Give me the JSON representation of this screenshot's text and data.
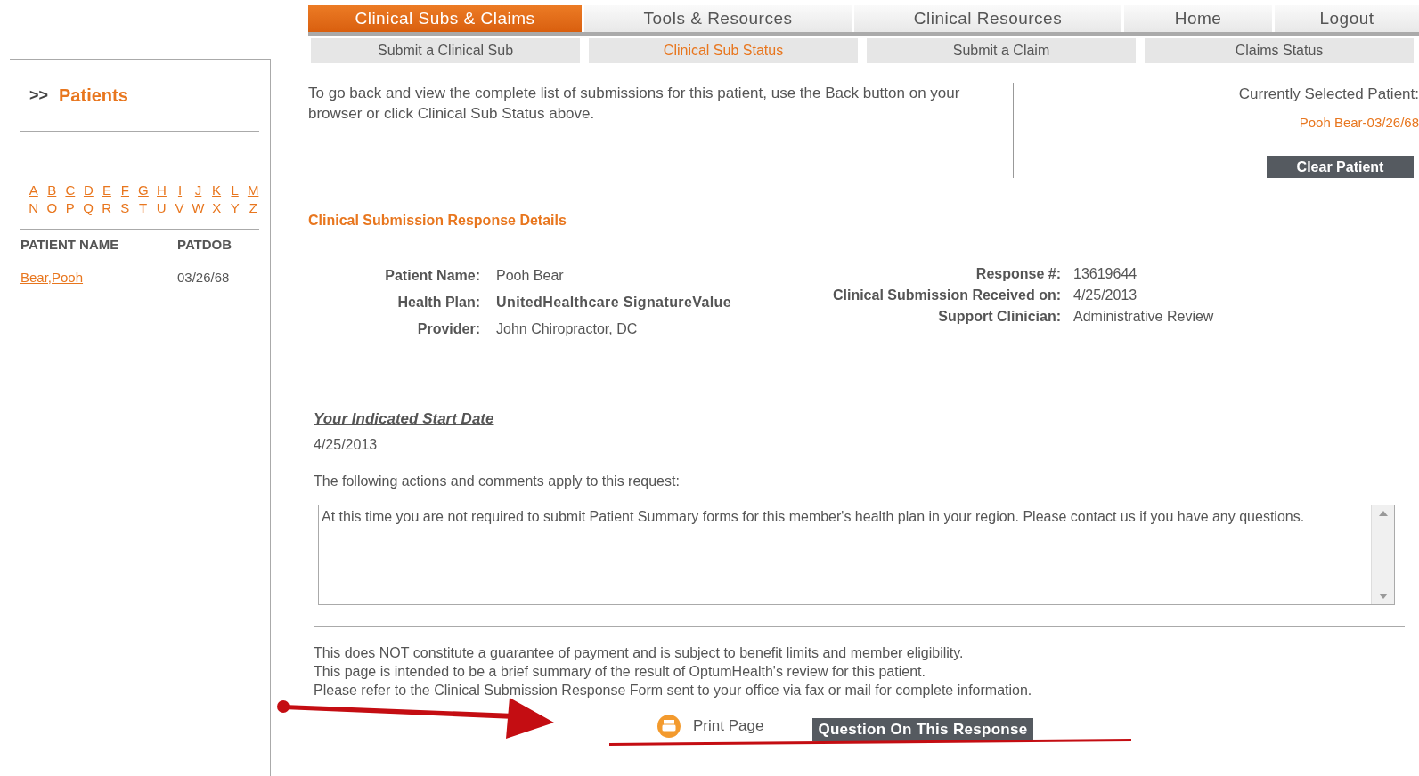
{
  "nav": {
    "tabs": [
      {
        "label": "Clinical Subs & Claims",
        "selected": true
      },
      {
        "label": "Tools & Resources",
        "selected": false
      },
      {
        "label": "Clinical Resources",
        "selected": false
      },
      {
        "label": "Home",
        "selected": false
      },
      {
        "label": "Logout",
        "selected": false
      }
    ],
    "subtabs": [
      {
        "label": "Submit a Clinical Sub",
        "selected": false
      },
      {
        "label": "Clinical Sub Status",
        "selected": true
      },
      {
        "label": "Submit a Claim",
        "selected": false
      },
      {
        "label": "Claims Status",
        "selected": false
      }
    ]
  },
  "sidebar": {
    "marker": ">>",
    "title": "Patients",
    "letters": [
      [
        "A",
        "B",
        "C",
        "D",
        "E",
        "F",
        "G",
        "H",
        "I",
        "J",
        "K",
        "L",
        "M"
      ],
      [
        "N",
        "O",
        "P",
        "Q",
        "R",
        "S",
        "T",
        "U",
        "V",
        "W",
        "X",
        "Y",
        "Z"
      ]
    ],
    "columns": [
      "PATIENT NAME",
      "PATDOB"
    ],
    "rows": [
      {
        "name": "Bear,Pooh",
        "dob": "03/26/68"
      }
    ]
  },
  "intro": "To go back and view the complete list of submissions for this patient, use the Back button on your browser or click Clinical Sub Status above.",
  "selected_patient": {
    "label": "Currently Selected Patient:",
    "value": "Pooh Bear-03/26/68",
    "button": "Clear Patient"
  },
  "section_title": "Clinical Submission Response Details",
  "details_left": [
    {
      "label": "Patient Name:",
      "value": "Pooh Bear",
      "emphasized": false
    },
    {
      "label": "Health Plan:",
      "value": "UnitedHealthcare SignatureValue",
      "emphasized": true
    },
    {
      "label": "Provider:",
      "value": "John Chiropractor, DC",
      "emphasized": false
    }
  ],
  "details_right": [
    {
      "label": "Response #:",
      "value": "13619644"
    },
    {
      "label": "Clinical Submission Received on:",
      "value": "4/25/2013"
    },
    {
      "label": "Support Clinician:",
      "value": "Administrative Review"
    }
  ],
  "start_date": {
    "heading": "Your Indicated Start Date",
    "value": "4/25/2013"
  },
  "actions_label": "The following actions and comments apply to this request:",
  "comments": "At this time you are not required to submit Patient Summary forms for this member's health plan in your region.  Please contact us if you have any questions.",
  "disclaimer": [
    "This does NOT constitute a guarantee of payment and is subject to benefit limits and member eligibility.",
    "This page is intended to be a brief summary of the result of OptumHealth's review for this patient.",
    "Please refer to the Clinical Submission Response Form sent to your office via fax or mail for complete information."
  ],
  "print_link": "Print Page",
  "question_button": "Question On This Response"
}
